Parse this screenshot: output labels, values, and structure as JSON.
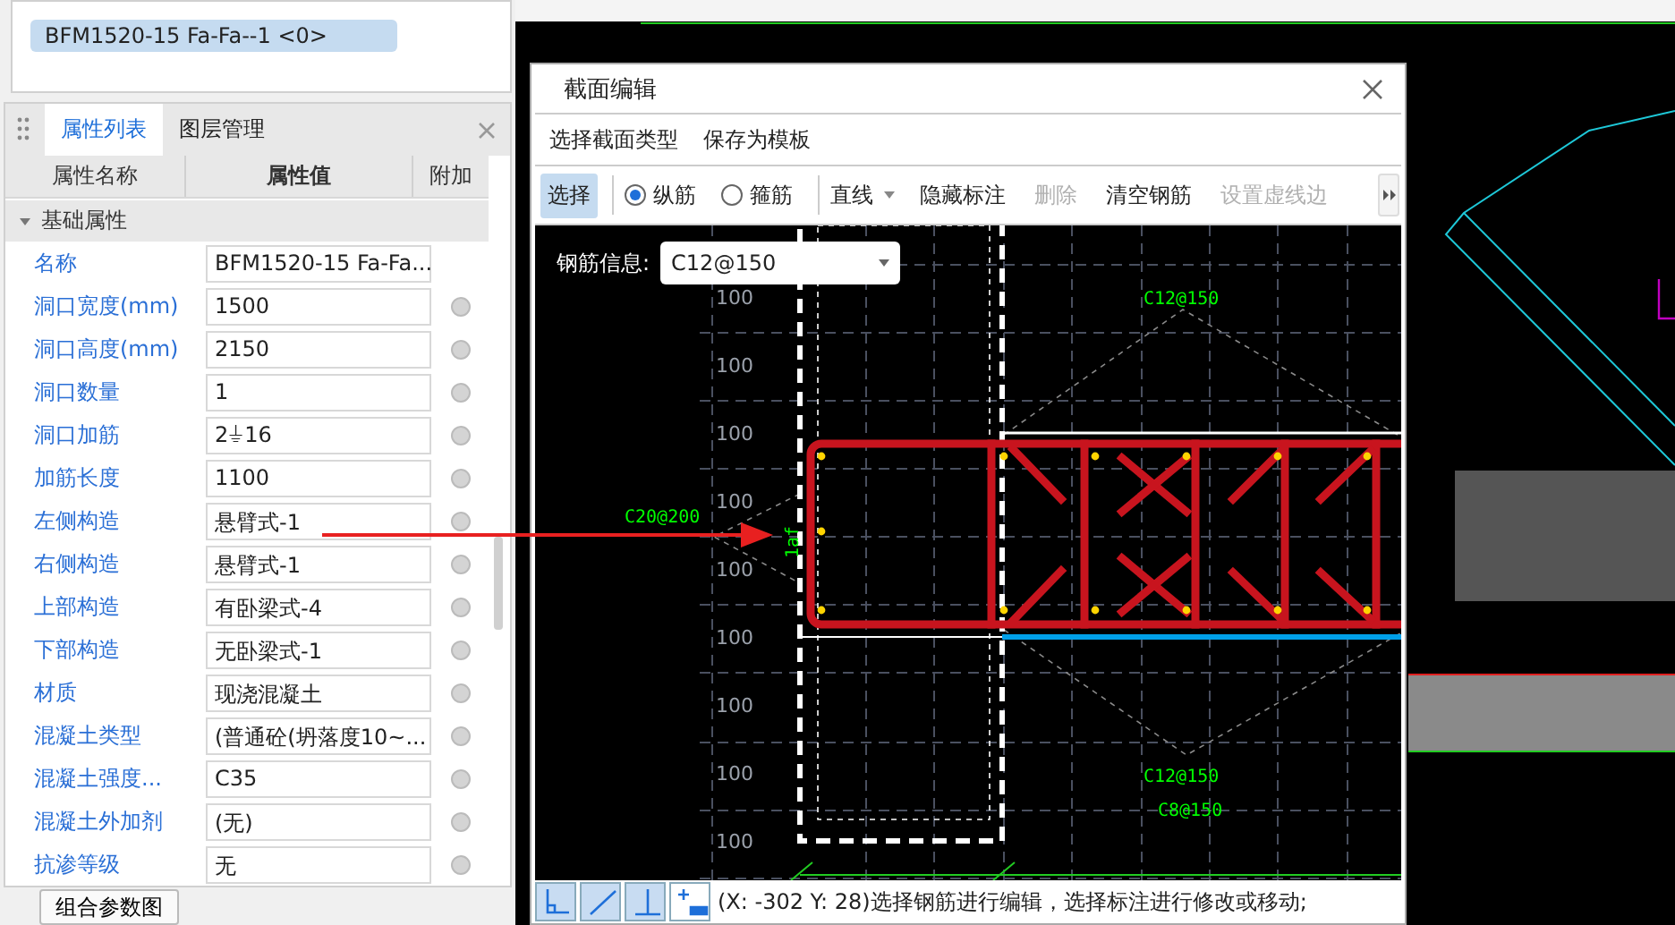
{
  "object_list": {
    "items": [
      {
        "label": "BFM1520-15 Fa-Fa--1 <0>",
        "selected": true
      }
    ]
  },
  "property_panel": {
    "tabs": [
      {
        "label": "属性列表",
        "selected": true
      },
      {
        "label": "图层管理",
        "selected": false
      }
    ],
    "columns": [
      "属性名称",
      "属性值",
      "附加"
    ],
    "group": {
      "label": "基础属性",
      "expanded": true
    },
    "rows": [
      {
        "name": "名称",
        "value": "BFM1520-15 Fa-Fa...",
        "attach": false
      },
      {
        "name": "洞口宽度(mm)",
        "value": "1500",
        "attach": true
      },
      {
        "name": "洞口高度(mm)",
        "value": "2150",
        "attach": true
      },
      {
        "name": "洞口数量",
        "value": "1",
        "attach": true
      },
      {
        "name": "洞口加筋",
        "value": "2⏚16",
        "attach": true
      },
      {
        "name": "加筋长度",
        "value": "1100",
        "attach": true
      },
      {
        "name": "左侧构造",
        "value": "悬臂式-1",
        "attach": true
      },
      {
        "name": "右侧构造",
        "value": "悬臂式-1",
        "attach": true
      },
      {
        "name": "上部构造",
        "value": "有卧梁式-4",
        "attach": true
      },
      {
        "name": "下部构造",
        "value": "无卧梁式-1",
        "attach": true
      },
      {
        "name": "材质",
        "value": "现浇混凝土",
        "attach": true
      },
      {
        "name": "混凝土类型",
        "value": "(普通砼(坍落度10~...",
        "attach": true
      },
      {
        "name": "混凝土强度...",
        "value": "C35",
        "attach": true
      },
      {
        "name": "混凝土外加剂",
        "value": "(无)",
        "attach": true
      },
      {
        "name": "抗渗等级",
        "value": "无",
        "attach": true
      }
    ],
    "button": "组合参数图"
  },
  "dialog": {
    "title": "截面编辑",
    "menu": [
      "选择截面类型",
      "保存为模板"
    ],
    "toolbar": [
      {
        "kind": "button",
        "label": "选择",
        "selected": true,
        "disabled": false
      },
      {
        "kind": "radio",
        "label": "纵筋",
        "checked": true
      },
      {
        "kind": "radio",
        "label": "箍筋",
        "checked": false
      },
      {
        "kind": "dropdown",
        "label": "直线"
      },
      {
        "kind": "button",
        "label": "隐藏标注",
        "selected": false,
        "disabled": false
      },
      {
        "kind": "button",
        "label": "删除",
        "selected": false,
        "disabled": true
      },
      {
        "kind": "button",
        "label": "清空钢筋",
        "selected": false,
        "disabled": false
      },
      {
        "kind": "button",
        "label": "设置虚线边",
        "selected": false,
        "disabled": true
      }
    ],
    "rebar_info": {
      "label": "钢筋信息:",
      "value": "C12@150"
    },
    "canvas": {
      "grid_labels": [
        "100",
        "100",
        "100",
        "100",
        "100",
        "100",
        "100",
        "100",
        "100"
      ],
      "annotations": [
        "C12@150",
        "C20@200",
        "1af",
        "C12@150",
        "C8@150"
      ]
    },
    "status_bar": {
      "tools": [
        {
          "kind": "orthogonal",
          "selected": true
        },
        {
          "kind": "line",
          "selected": true
        },
        {
          "kind": "perpendicular",
          "selected": true
        },
        {
          "kind": "add",
          "selected": false
        }
      ],
      "text": "(X: -302 Y: 28)选择钢筋进行编辑，选择标注进行修改或移动;"
    }
  }
}
